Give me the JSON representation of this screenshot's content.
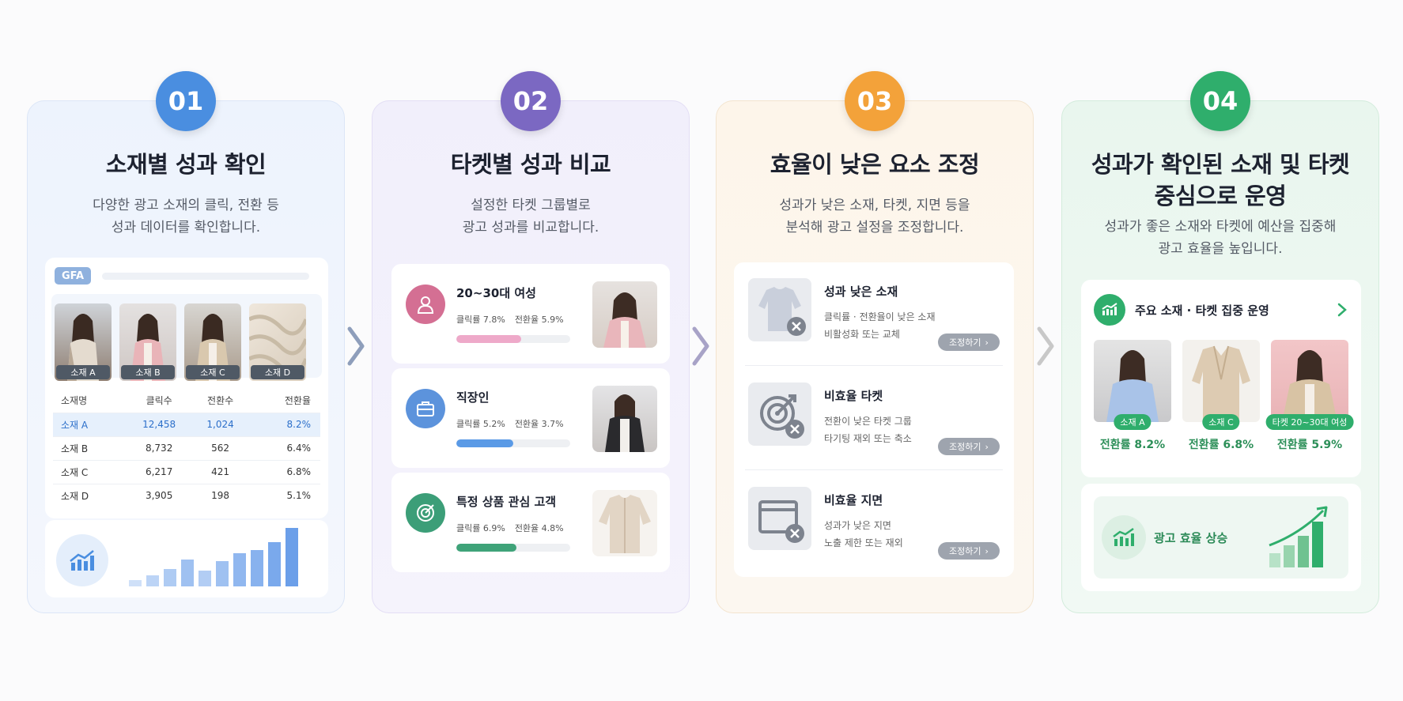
{
  "steps": [
    {
      "num": "01",
      "title": "소재별 성과 확인",
      "desc1": "다양한 광고 소재의 클릭, 전환 등",
      "desc2": "성과 데이터를 확인합니다."
    },
    {
      "num": "02",
      "title": "타켓별 성과 비교",
      "desc1": "설정한 타켓 그룹별로",
      "desc2": "광고 성과를 비교합니다."
    },
    {
      "num": "03",
      "title": "효율이 낮은 요소 조정",
      "desc1": "성과가 낮은 소재, 타켓, 지면 등을",
      "desc2": "분석해 광고 설정을 조정합니다."
    },
    {
      "num": "04",
      "title1": "성과가 확인된 소재 및 타켓",
      "title2": "중심으로 운영",
      "desc1": "성과가 좋은 소재와 타켓에 예산을 집중해",
      "desc2": "광고 효율을 높입니다."
    }
  ],
  "step1": {
    "gfa": "GFA",
    "thumbs": [
      "소재 A",
      "소재 B",
      "소재 C",
      "소재 D"
    ],
    "headers": [
      "소재명",
      "클릭수",
      "전환수",
      "전환율"
    ],
    "rows": [
      [
        "소재 A",
        "12,458",
        "1,024",
        "8.2%"
      ],
      [
        "소재 B",
        "8,732",
        "562",
        "6.4%"
      ],
      [
        "소재 C",
        "6,217",
        "421",
        "6.8%"
      ],
      [
        "소재 D",
        "3,905",
        "198",
        "5.1%"
      ]
    ]
  },
  "step2": {
    "rows": [
      {
        "title": "20~30대 여성",
        "click": "클릭률 7.8%",
        "conv": "전환율 5.9%",
        "progress": 0.57,
        "color": "#eea9c9",
        "icon": "person-icon"
      },
      {
        "title": "직장인",
        "click": "클릭률 5.2%",
        "conv": "전환율 3.7%",
        "progress": 0.5,
        "color": "#5a9ae6",
        "icon": "briefcase-icon"
      },
      {
        "title": "특정 상품 관심 고객",
        "click": "클릭률 6.9%",
        "conv": "전환율 4.8%",
        "progress": 0.53,
        "color": "#3fa379",
        "icon": "target-icon"
      }
    ]
  },
  "step3": {
    "rows": [
      {
        "title": "성과 낮은 소재",
        "d1": "클릭률 · 전환율이 낮은 소재",
        "d2": "비활성화 또는 교체",
        "btn": "조정하기"
      },
      {
        "title": "비효율 타켓",
        "d1": "전환이 낮은 타켓 그룹",
        "d2": "타기팅 재외 또는 축소",
        "btn": "조정하기"
      },
      {
        "title": "비효율 지면",
        "d1": "성과가 낮은 지면",
        "d2": "노출 제한 또는 재외",
        "btn": "조정하기"
      }
    ]
  },
  "step4": {
    "head": "주요 소재 · 타켓 집중 운영",
    "items": [
      {
        "tag": "소재 A",
        "rate": "전환률 8.2%"
      },
      {
        "tag": "소재 C",
        "rate": "전환률 6.8%"
      },
      {
        "tag": "타켓 20~30대 여성",
        "rate": "전환률 5.9%"
      }
    ],
    "bottom": "광고 효율 상승"
  },
  "colors": {
    "blue": "#4a8ee0",
    "purple": "#7b68c2",
    "orange": "#f3a23a",
    "green": "#2fae6c"
  }
}
